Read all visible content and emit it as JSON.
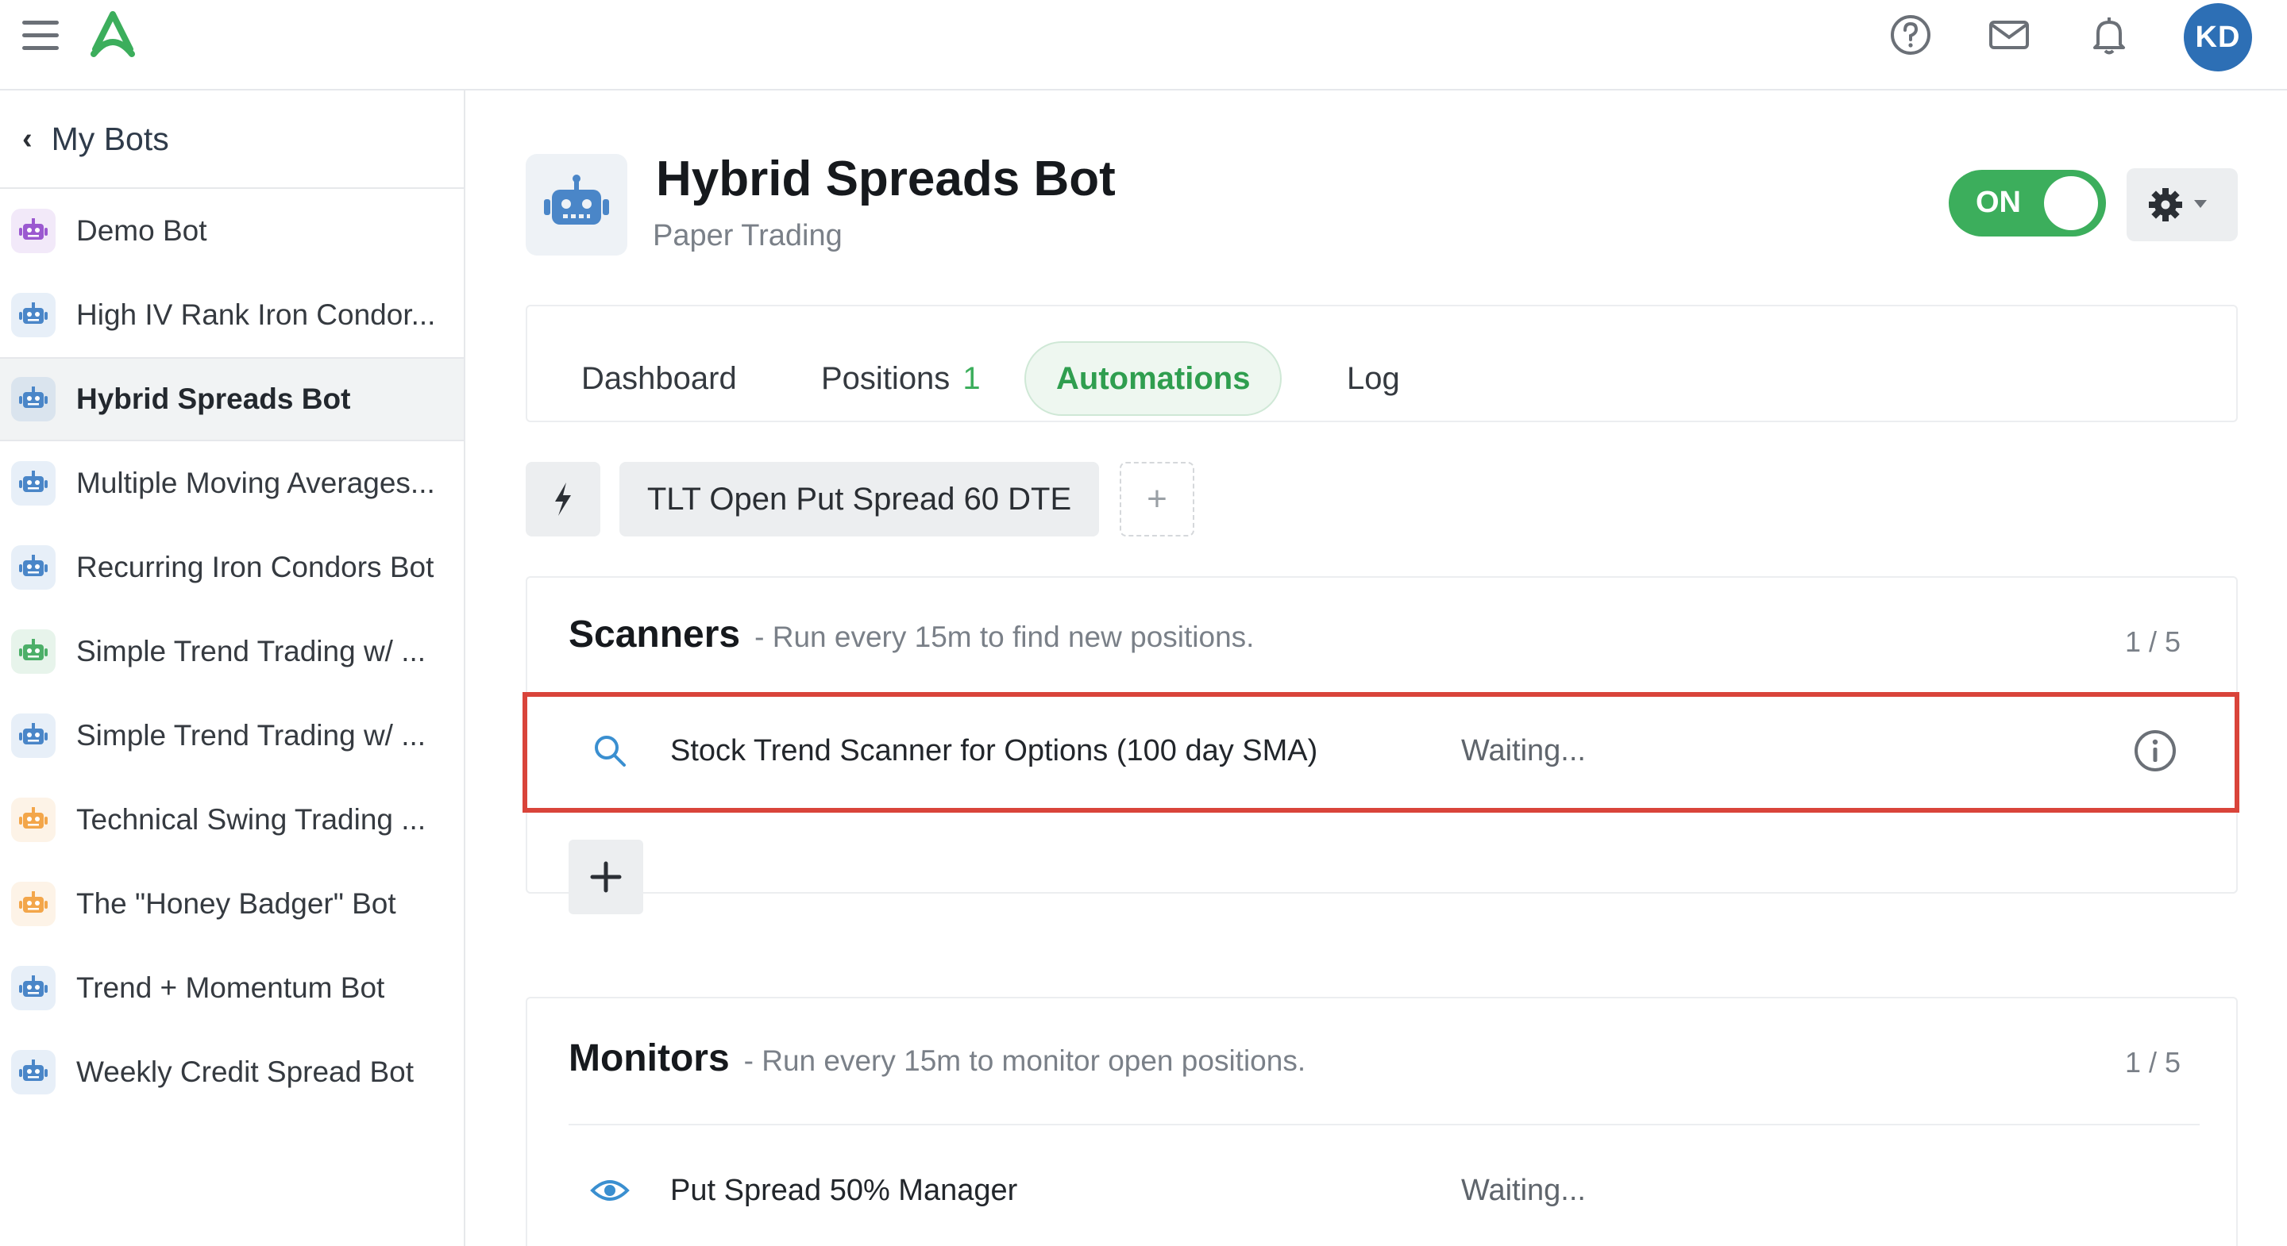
{
  "header": {
    "avatar_initials": "KD",
    "accent_color": "#3cae5c",
    "icons": [
      "menu-icon",
      "logo",
      "help-icon",
      "mail-icon",
      "bell-icon"
    ]
  },
  "sidebar": {
    "back_label": "My Bots",
    "items": [
      {
        "label": "Demo Bot",
        "color": "#9b59d0"
      },
      {
        "label": "High IV Rank Iron Condor...",
        "color": "#4a86c8"
      },
      {
        "label": "Hybrid Spreads Bot",
        "color": "#4a86c8",
        "active": true
      },
      {
        "label": "Multiple Moving Averages...",
        "color": "#4a86c8"
      },
      {
        "label": "Recurring Iron Condors Bot",
        "color": "#4a86c8"
      },
      {
        "label": "Simple Trend Trading w/ ...",
        "color": "#4caf68"
      },
      {
        "label": "Simple Trend Trading w/ ...",
        "color": "#4a86c8"
      },
      {
        "label": "Technical Swing Trading ...",
        "color": "#f3a64a"
      },
      {
        "label": "The \"Honey Badger\" Bot",
        "color": "#f3a64a"
      },
      {
        "label": "Trend + Momentum Bot",
        "color": "#4a86c8"
      },
      {
        "label": "Weekly Credit Spread Bot",
        "color": "#4a86c8"
      }
    ]
  },
  "bot": {
    "title": "Hybrid Spreads Bot",
    "subtitle": "Paper Trading",
    "toggle_label": "ON"
  },
  "tabs": {
    "dashboard": "Dashboard",
    "positions": "Positions",
    "positions_count": "1",
    "automations": "Automations",
    "log": "Log"
  },
  "automation": {
    "chip_label": "TLT Open Put Spread 60 DTE",
    "add_label": "+"
  },
  "scanners": {
    "title": "Scanners",
    "description": "- Run every 15m to find new positions.",
    "count": "1 / 5",
    "row_name": "Stock Trend Scanner for Options (100 day SMA)",
    "row_status": "Waiting..."
  },
  "monitors": {
    "title": "Monitors",
    "description": "- Run every 15m to monitor open positions.",
    "count": "1 / 5",
    "row_name": "Put Spread 50% Manager",
    "row_status": "Waiting..."
  }
}
